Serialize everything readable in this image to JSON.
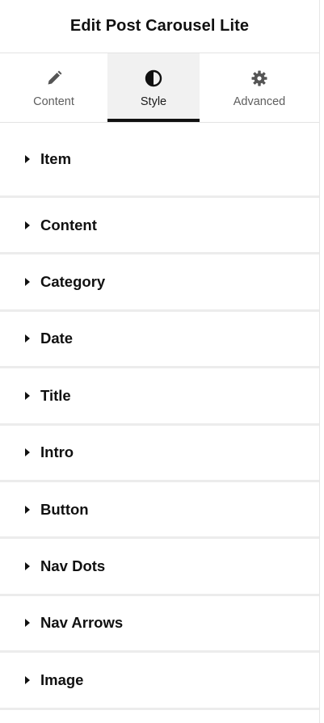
{
  "header": {
    "title": "Edit Post Carousel Lite"
  },
  "tabs": [
    {
      "label": "Content",
      "icon": "pencil-icon",
      "active": false
    },
    {
      "label": "Style",
      "icon": "half-circle-icon",
      "active": true
    },
    {
      "label": "Advanced",
      "icon": "gear-icon",
      "active": false
    }
  ],
  "sections": [
    {
      "label": "Item"
    },
    {
      "label": "Content"
    },
    {
      "label": "Category"
    },
    {
      "label": "Date"
    },
    {
      "label": "Title"
    },
    {
      "label": "Intro"
    },
    {
      "label": "Button"
    },
    {
      "label": "Nav Dots"
    },
    {
      "label": "Nav Arrows"
    },
    {
      "label": "Image"
    }
  ],
  "colors": {
    "active_tab_bg": "#f1f1f1",
    "accent": "#111111",
    "divider": "#ececec"
  }
}
